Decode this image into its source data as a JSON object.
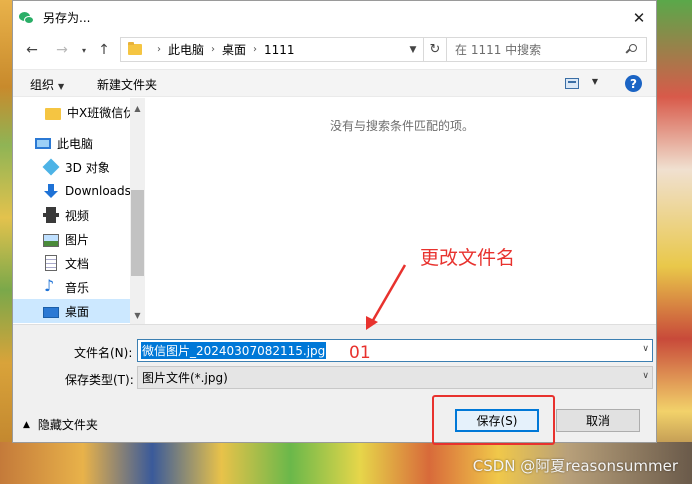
{
  "window": {
    "title": "另存为..."
  },
  "address": {
    "crumbs": [
      "此电脑",
      "桌面",
      "1111"
    ],
    "search_placeholder": "在 1111 中搜索"
  },
  "toolbar": {
    "organize_label": "组织",
    "new_folder_label": "新建文件夹"
  },
  "nav": {
    "items": [
      {
        "label": "中X班微信伏",
        "icon": "folder-icon"
      },
      {
        "label": "此电脑",
        "icon": "computer-icon"
      },
      {
        "label": "3D 对象",
        "icon": "3d-objects-icon"
      },
      {
        "label": "Downloads",
        "icon": "downloads-icon"
      },
      {
        "label": "视频",
        "icon": "video-icon"
      },
      {
        "label": "图片",
        "icon": "pictures-icon"
      },
      {
        "label": "文档",
        "icon": "documents-icon"
      },
      {
        "label": "音乐",
        "icon": "music-icon"
      },
      {
        "label": "桌面",
        "icon": "desktop-icon",
        "selected": true
      }
    ]
  },
  "filelist": {
    "empty_message": "没有与搜索条件匹配的项。"
  },
  "form": {
    "filename_label": "文件名(N):",
    "filename_value": "微信图片_20240307082115.jpg",
    "filetype_label": "保存类型(T):",
    "filetype_value": "图片文件(*.jpg)",
    "hide_folders_label": "隐藏文件夹",
    "save_label": "保存(S)",
    "cancel_label": "取消"
  },
  "annotation": {
    "note": "更改文件名",
    "number": "01",
    "color": "#e8322e"
  },
  "watermark": "CSDN @阿夏reasonsummer"
}
